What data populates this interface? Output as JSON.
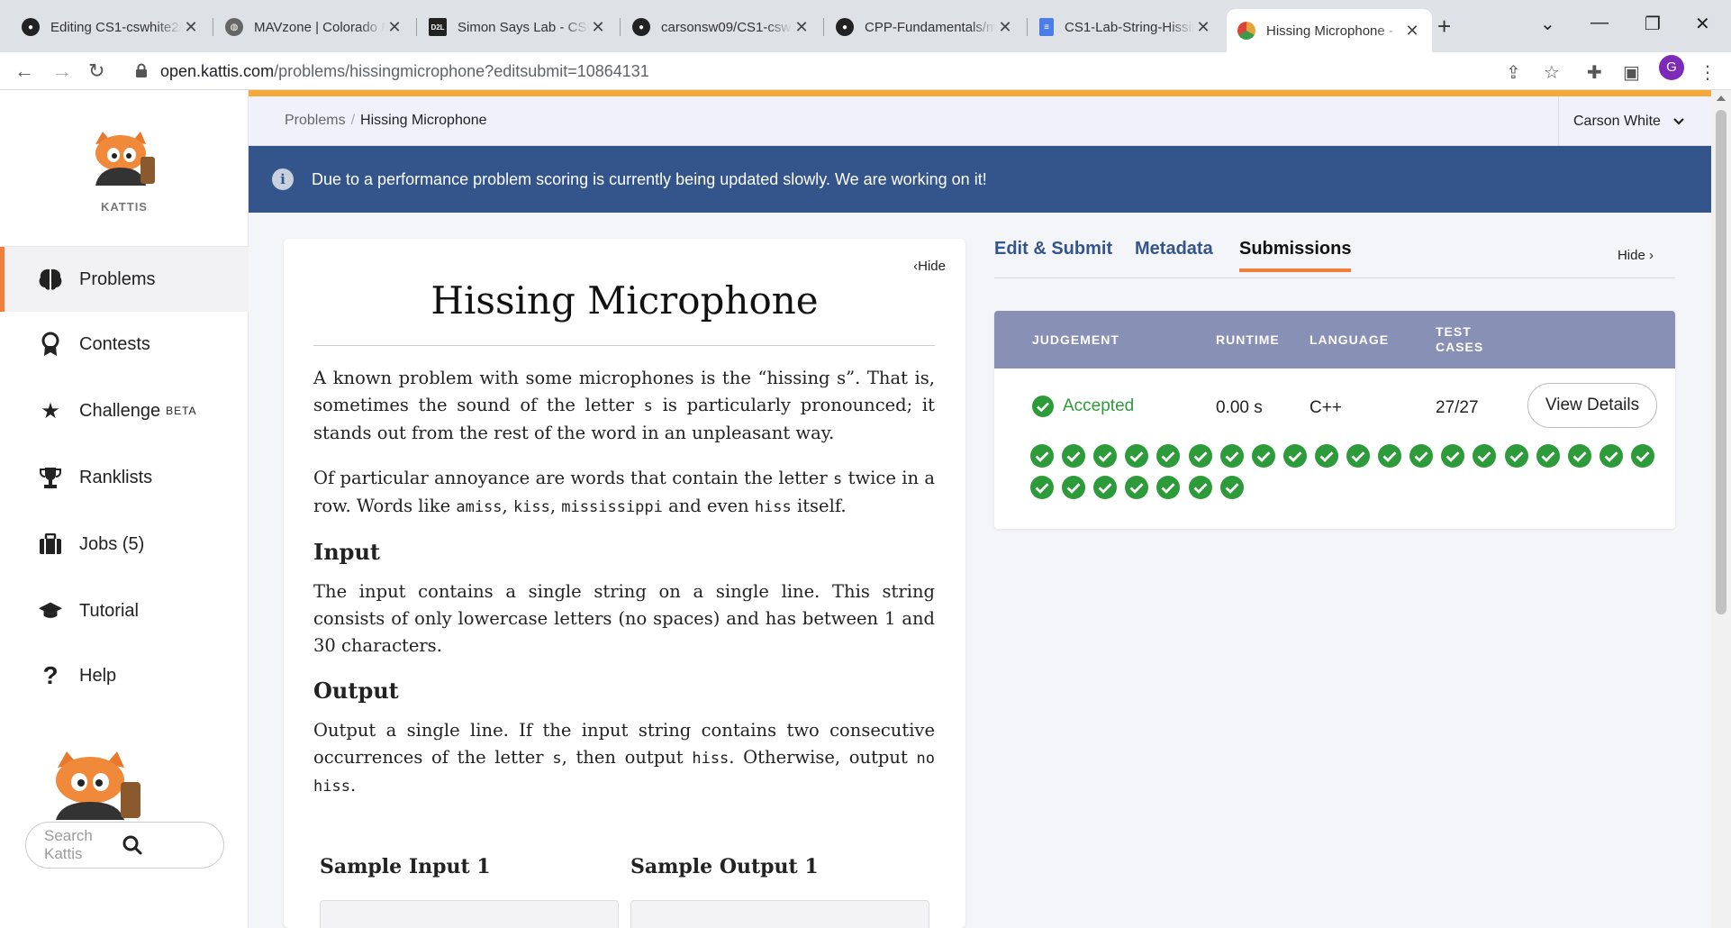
{
  "browser": {
    "tabs": [
      {
        "title": "Editing CS1-cswhite2/",
        "favicon": "github-icon"
      },
      {
        "title": "MAVzone | Colorado M",
        "favicon": "globe-icon"
      },
      {
        "title": "Simon Says Lab - CSC",
        "favicon": "d2l-icon",
        "favicon_text": "D2L"
      },
      {
        "title": "carsonsw09/CS1-cswh",
        "favicon": "github-icon"
      },
      {
        "title": "CPP-Fundamentals/m",
        "favicon": "github-icon"
      },
      {
        "title": "CS1-Lab-String-Hissin",
        "favicon": "docs-icon"
      },
      {
        "title": "Hissing Microphone -",
        "favicon": "kattis-icon",
        "active": true
      }
    ],
    "new_tab_label": "+",
    "url_host": "open.kattis.com",
    "url_path": "/problems/hissingmicrophone?editsubmit=10864131",
    "profile_initial": "G"
  },
  "sidebar": {
    "logo_text": "KATTIS",
    "items": [
      {
        "label": "Problems",
        "icon": "brain-icon",
        "active": true
      },
      {
        "label": "Contests",
        "icon": "medal-icon"
      },
      {
        "label": "Challenge",
        "icon": "star-icon",
        "sup": "BETA"
      },
      {
        "label": "Ranklists",
        "icon": "trophy-icon"
      },
      {
        "label": "Jobs (5)",
        "icon": "briefcase-icon"
      },
      {
        "label": "Tutorial",
        "icon": "graduation-cap-icon"
      },
      {
        "label": "Help",
        "icon": "question-icon"
      }
    ],
    "search_placeholder": "Search Kattis"
  },
  "header": {
    "breadcrumb_root": "Problems",
    "breadcrumb_sep": "/",
    "breadcrumb_current": "Hissing Microphone",
    "user_name": "Carson White"
  },
  "banner": {
    "text": "Due to a performance problem scoring is currently being updated slowly. We are working on it!"
  },
  "problem": {
    "hide_label": "Hide",
    "title": "Hissing Microphone",
    "para1_a": "A known problem with some microphones is the “hissing s”. That is, sometimes the sound of the letter ",
    "para1_s": "s",
    "para1_b": " is particularly pronounced; it stands out from the rest of the word in an unpleasant way.",
    "para2_a": "Of particular annoyance are words that contain the letter ",
    "para2_s": "s",
    "para2_b": " twice in a row. Words like ",
    "para2_w1": "amiss",
    "para2_c1": ", ",
    "para2_w2": "kiss",
    "para2_c2": ", ",
    "para2_w3": "mississippi",
    "para2_c3": " and even ",
    "para2_w4": "hiss",
    "para2_c4": " itself.",
    "input_heading": "Input",
    "input_text": "The input contains a single string on a single line. This string consists of only lowercase letters (no spaces) and has between 1 and 30 characters.",
    "output_heading": "Output",
    "output_a": "Output a single line. If the input string contains two consecutive occurrences of the letter ",
    "output_s": "s",
    "output_b": ", then output ",
    "output_hiss": "hiss",
    "output_c": ". Otherwise, output ",
    "output_nohiss": "no hiss",
    "output_d": ".",
    "sample_input_heading": "Sample Input 1",
    "sample_output_heading": "Sample Output 1"
  },
  "submissions": {
    "tabs": [
      "Edit & Submit",
      "Metadata",
      "Submissions"
    ],
    "active_tab": "Submissions",
    "hide_label": "Hide",
    "columns": [
      "JUDGEMENT",
      "RUNTIME",
      "LANGUAGE",
      "TEST CASES"
    ],
    "row": {
      "judgement": "Accepted",
      "runtime": "0.00 s",
      "language": "C++",
      "test_cases": "27/27",
      "details_label": "View Details"
    },
    "passed_tests": 27,
    "colors": {
      "accepted": "#2e9b3a",
      "header": "#8890b5",
      "accent": "#f07f3c",
      "banner": "#34558b"
    }
  }
}
